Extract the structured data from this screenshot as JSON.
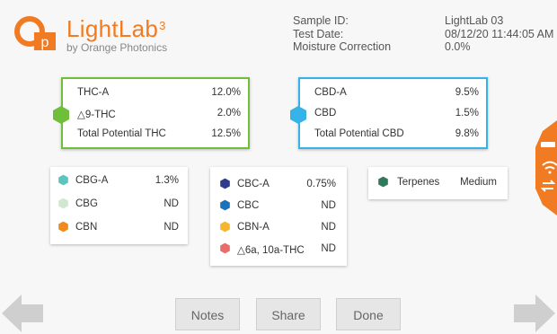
{
  "brand": {
    "name": "LightLab",
    "superscript": "3",
    "subtitle": "by Orange Photonics",
    "color": "#f07b22"
  },
  "sample_info": {
    "sample_id_label": "Sample ID:",
    "sample_id_value": "LightLab 03",
    "test_date_label": "Test Date:",
    "test_date_value": "08/12/20 11:44:05 AM",
    "moisture_label": "Moisture Correction",
    "moisture_value": "0.0%"
  },
  "thc_card": {
    "border_color": "#6fbf3a",
    "rows": [
      {
        "label": "THC-A",
        "value": "12.0%"
      },
      {
        "label": "△9-THC",
        "value": "2.0%"
      },
      {
        "label": "Total Potential THC",
        "value": "12.5%"
      }
    ]
  },
  "cbd_card": {
    "border_color": "#35b3e6",
    "rows": [
      {
        "label": "CBD-A",
        "value": "9.5%"
      },
      {
        "label": "CBD",
        "value": "1.5%"
      },
      {
        "label": "Total Potential CBD",
        "value": "9.8%"
      }
    ]
  },
  "cbg_card": {
    "rows": [
      {
        "label": "CBG-A",
        "value": "1.3%",
        "color": "#5ec4be"
      },
      {
        "label": "CBG",
        "value": "ND",
        "color": "#cfe8cf"
      },
      {
        "label": "CBN",
        "value": "ND",
        "color": "#f08a1c"
      }
    ]
  },
  "cbc_card": {
    "rows": [
      {
        "label": "CBC-A",
        "value": "0.75%",
        "color": "#2e3b8c"
      },
      {
        "label": "CBC",
        "value": "ND",
        "color": "#1a73b8"
      },
      {
        "label": "CBN-A",
        "value": "ND",
        "color": "#f5b62a"
      },
      {
        "label": "△6a, 10a-THC",
        "value": "ND",
        "color": "#e96d6d"
      }
    ]
  },
  "terpenes_card": {
    "label": "Terpenes",
    "value": "Medium",
    "color": "#2f7a5a"
  },
  "buttons": {
    "notes": "Notes",
    "share": "Share",
    "done": "Done"
  },
  "icons": {
    "thc_hex": "hexagon-green-icon",
    "cbd_hex": "hexagon-blue-icon",
    "prev": "arrow-left-icon",
    "next": "arrow-right-icon",
    "side_menu": "side-menu-icon"
  }
}
